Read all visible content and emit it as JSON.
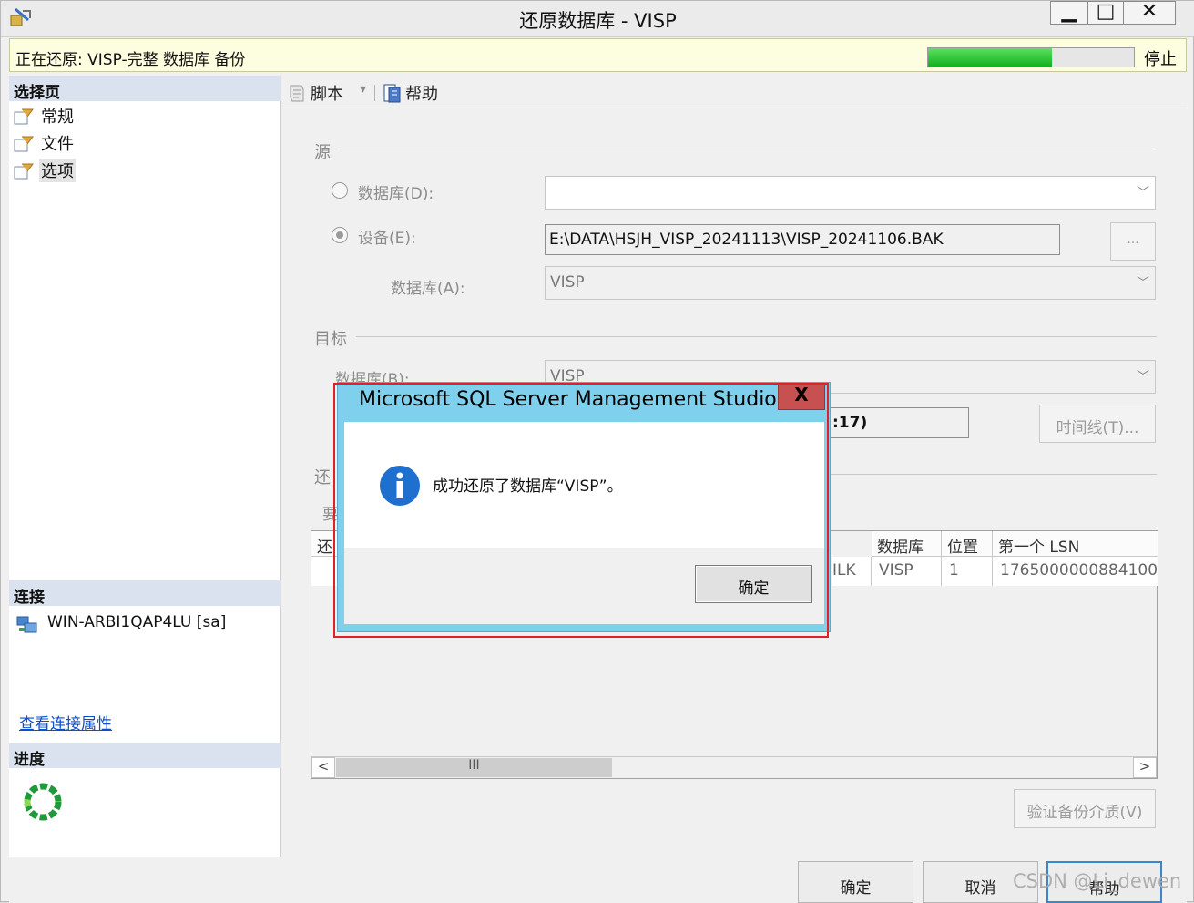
{
  "window": {
    "title": "还原数据库 - VISP",
    "min_label": "▁",
    "max_label": "□",
    "close_label": "✕"
  },
  "status": {
    "text": "正在还原: VISP-完整 数据库 备份",
    "progress": 0.6,
    "stop_label": "停止"
  },
  "left": {
    "select_page_title": "选择页",
    "pages": [
      {
        "label": "常规"
      },
      {
        "label": "文件"
      },
      {
        "label": "选项"
      }
    ],
    "connection_title": "连接",
    "server": "WIN-ARBI1QAP4LU [sa]",
    "conn_link": "查看连接属性",
    "progress_title": "进度"
  },
  "toolbar": {
    "script_label": "脚本",
    "script_arrow": "▾",
    "help_label": "帮助"
  },
  "source": {
    "title": "源",
    "database_radio": "数据库(D):",
    "device_radio": "设备(E):",
    "device_path": "E:\\DATA\\HSJH_VISP_20241113\\VISP_20241106.BAK",
    "browse_label": "...",
    "database_label": "数据库(A):",
    "database_value": "VISP"
  },
  "target": {
    "title": "目标",
    "database_label": "数据库(B):",
    "database_value": "VISP",
    "restore_to_value": ":17)",
    "timeline_label": "时间线(T)..."
  },
  "plan": {
    "title_partial": "还",
    "sub_partial": "要",
    "columns": [
      "还",
      "数据库",
      "位置",
      "第一个 LSN"
    ],
    "row": {
      "partial_col": "ILK",
      "database": "VISP",
      "position": "1",
      "first_lsn": "1765000000884100"
    },
    "scroll_left": "<",
    "scroll_right": ">",
    "scroll_thumb": "III"
  },
  "verify_label": "验证备份介质(V)",
  "bottom": {
    "ok": "确定",
    "cancel": "取消",
    "help": "帮助"
  },
  "watermark": "CSDN @Li_dewen",
  "dialog": {
    "title": "Microsoft SQL Server Management Studio",
    "close": "X",
    "message": "成功还原了数据库“VISP”。",
    "ok": "确定"
  }
}
